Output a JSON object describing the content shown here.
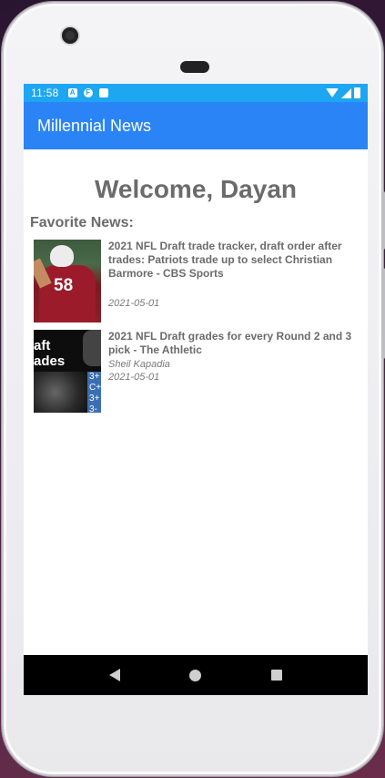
{
  "status_bar": {
    "time": "11:58",
    "icons": [
      "a-icon",
      "flipboard-icon",
      "sd-card-icon",
      "wifi-icon",
      "signal-icon",
      "battery-icon"
    ]
  },
  "app_bar": {
    "title": "Millennial News"
  },
  "welcome": {
    "text": "Welcome, Dayan"
  },
  "favorites": {
    "heading": "Favorite News:",
    "items": [
      {
        "headline": "2021 NFL Draft trade tracker, draft order after trades: Patriots trade up to select Christian Barmore - CBS Sports",
        "author": "",
        "date": "2021-05-01",
        "thumb_text": "58"
      },
      {
        "headline": "2021 NFL Draft grades for every Round 2 and 3 pick - The Athletic",
        "author": "Sheil Kapadia",
        "date": "2021-05-01",
        "thumb_text_1": "aft",
        "thumb_text_2": "ades",
        "thumb_grades": "3+\nC+\n3+\n3-"
      }
    ]
  },
  "colors": {
    "status_bar": "#1da6f2",
    "app_bar": "#2b84f5",
    "text_gray": "#6b6b6b"
  }
}
